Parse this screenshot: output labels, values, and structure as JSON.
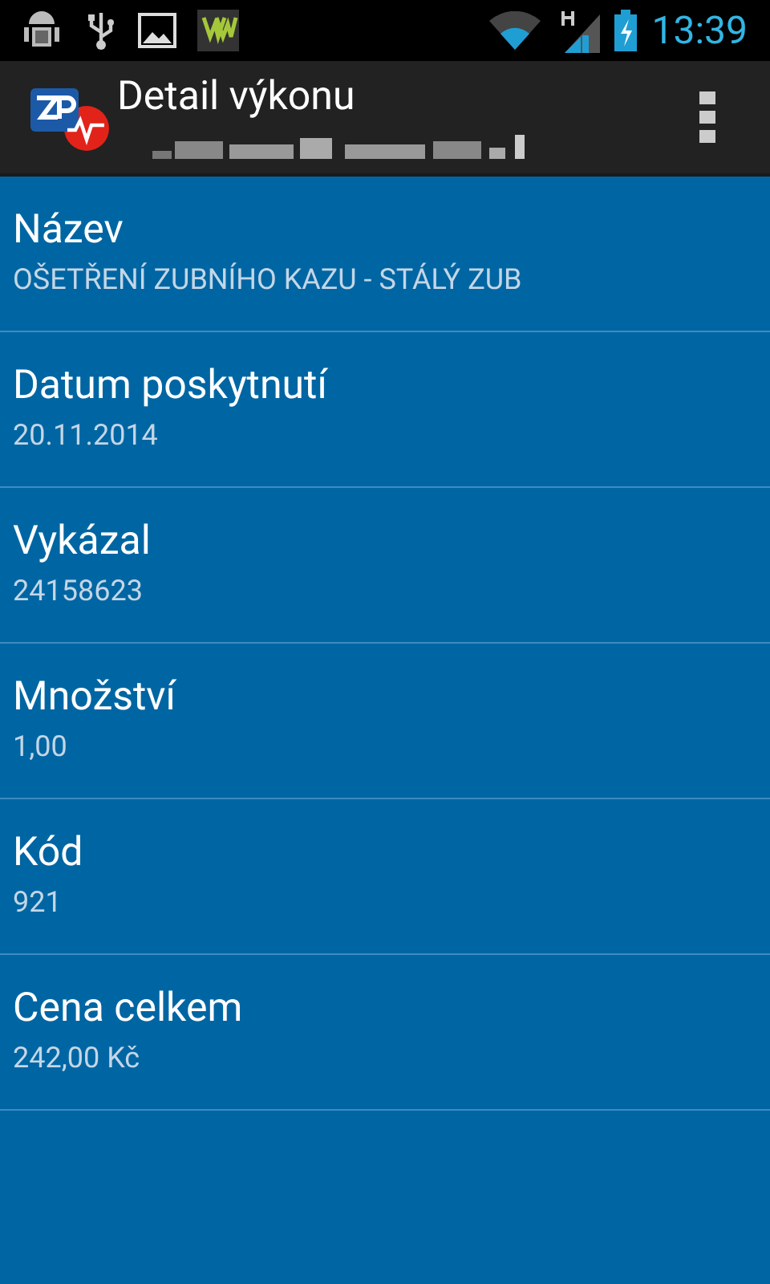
{
  "status_bar": {
    "time": "13:39"
  },
  "action_bar": {
    "title": "Detail výkonu"
  },
  "fields": [
    {
      "label": "Název",
      "value": "OŠETŘENÍ ZUBNÍHO KAZU - STÁLÝ ZUB"
    },
    {
      "label": "Datum poskytnutí",
      "value": "20.11.2014"
    },
    {
      "label": "Vykázal",
      "value": "24158623"
    },
    {
      "label": "Množství",
      "value": "1,00"
    },
    {
      "label": "Kód",
      "value": "921"
    },
    {
      "label": "Cena celkem",
      "value": "242,00 Kč"
    }
  ]
}
